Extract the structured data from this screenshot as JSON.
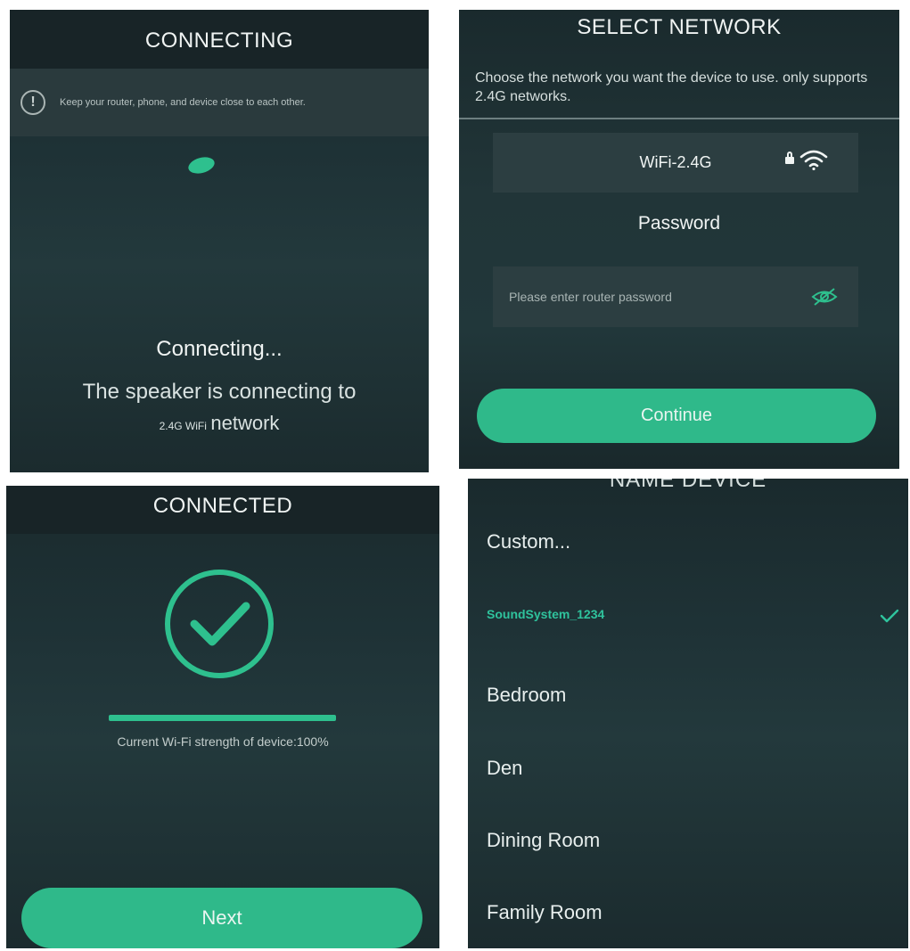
{
  "colors": {
    "accent": "#2fb98a",
    "background": "#1f3337",
    "text": "#f0f4f3"
  },
  "connecting": {
    "title": "CONNECTING",
    "notice": "Keep your router, phone, and device close to each other.",
    "notice_icon": "info-icon",
    "status_title": "Connecting...",
    "line1": "The speaker is connecting to",
    "line2_small": "2.4G WiFi",
    "line2_big": "network"
  },
  "select_network": {
    "title": "SELECT NETWORK",
    "intro": "Choose the network you want the device to use. only supports 2.4G networks.",
    "network_name": "WiFi-2.4G",
    "password_label": "Password",
    "password_placeholder": "Please enter router password",
    "continue_label": "Continue"
  },
  "connected": {
    "title": "CONNECTED",
    "wifi_strength": 1.0,
    "strength_text": "Current Wi-Fi strength of device:100%",
    "next_label": "Next"
  },
  "name_device": {
    "title": "NAME DEVICE",
    "items": [
      {
        "label": "Custom..."
      },
      {
        "label": "SoundSystem_1234",
        "selected": true
      },
      {
        "label": "Bedroom"
      },
      {
        "label": "Den"
      },
      {
        "label": "Dining Room"
      },
      {
        "label": "Family Room"
      }
    ]
  }
}
